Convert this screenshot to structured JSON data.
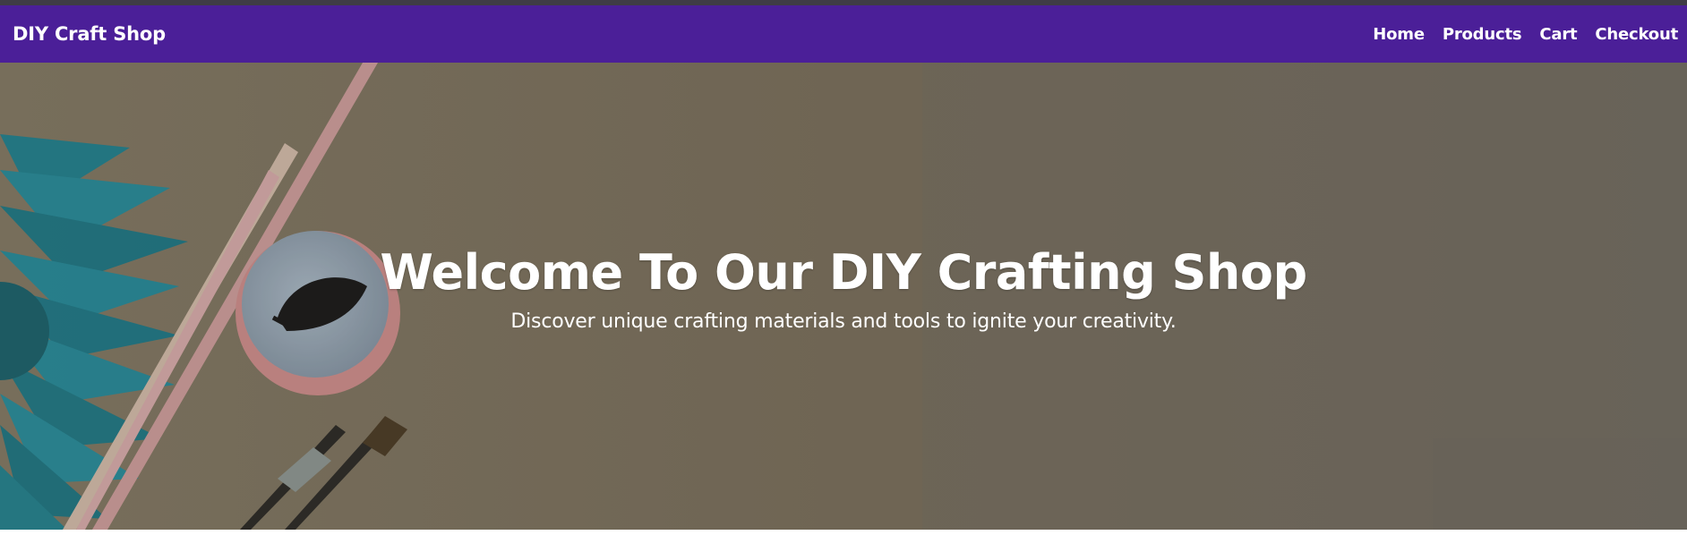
{
  "navbar": {
    "brand": "DIY Craft Shop",
    "links": [
      "Home",
      "Products",
      "Cart",
      "Checkout"
    ],
    "background_color": "#4b1f98"
  },
  "hero": {
    "title": "Welcome To Our DIY Crafting Shop",
    "subtitle": "Discover unique crafting materials and tools to ignite your creativity."
  }
}
